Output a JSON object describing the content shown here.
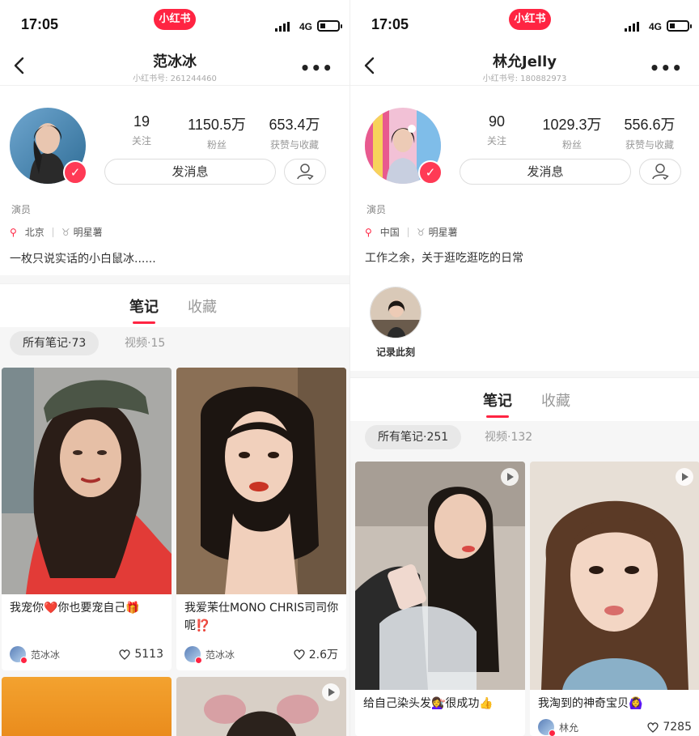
{
  "colors": {
    "brand": "#ff2442",
    "text": "#333333",
    "muted": "#999999"
  },
  "left": {
    "status": {
      "time": "17:05",
      "logo": "小红书",
      "network": "4G"
    },
    "nav": {
      "title": "范冰冰",
      "subtitle": "小红书号: 261244460"
    },
    "stats": [
      {
        "num": "19",
        "label": "关注"
      },
      {
        "num": "1150.5万",
        "label": "粉丝"
      },
      {
        "num": "653.4万",
        "label": "获赞与收藏"
      }
    ],
    "message_label": "发消息",
    "occupation": "演员",
    "location": "北京",
    "tag": "明星薯",
    "bio": "一枚只说实话的小白鼠冰......",
    "tabs": {
      "notes": "笔记",
      "collect": "收藏"
    },
    "filters": {
      "all": "所有笔记·73",
      "video": "视频·15"
    },
    "cards": [
      {
        "caption": "我宠你❤️你也要宠自己🎁",
        "author": "范冰冰",
        "likes": "5113"
      },
      {
        "caption": "我爱茉仕MONO CHRIS司司你呢⁉️",
        "author": "范冰冰",
        "likes": "2.6万"
      }
    ]
  },
  "right": {
    "status": {
      "time": "17:05",
      "logo": "小红书",
      "network": "4G"
    },
    "nav": {
      "title": "林允Jelly",
      "subtitle": "小红书号: 180882973"
    },
    "stats": [
      {
        "num": "90",
        "label": "关注"
      },
      {
        "num": "1029.3万",
        "label": "粉丝"
      },
      {
        "num": "556.6万",
        "label": "获赞与收藏"
      }
    ],
    "message_label": "发消息",
    "occupation": "演员",
    "location": "中国",
    "tag": "明星薯",
    "bio": "工作之余，关于逛吃逛吃的日常",
    "highlight_label": "记录此刻",
    "tabs": {
      "notes": "笔记",
      "collect": "收藏"
    },
    "filters": {
      "all": "所有笔记·251",
      "video": "视频·132"
    },
    "cards": [
      {
        "caption": "给自己染头发💇‍♀️很成功👍"
      },
      {
        "caption": "我淘到的神奇宝贝🙆‍♀️",
        "author": "林允",
        "likes": "7285"
      }
    ]
  }
}
